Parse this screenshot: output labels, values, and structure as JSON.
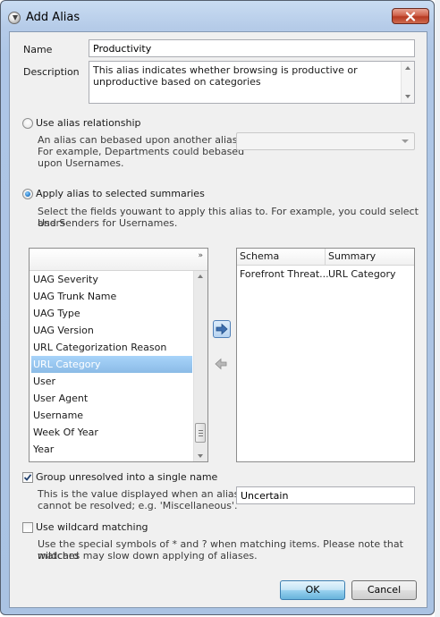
{
  "window": {
    "title": "Add Alias",
    "close_icon": "close-x"
  },
  "form": {
    "name_label": "Name",
    "name_value": "Productivity",
    "description_label": "Description",
    "description_value": "This alias indicates whether browsing is productive or unproductive based on categories"
  },
  "relationship": {
    "label": "Use alias relationship",
    "hint_line1": "An alias can bebased upon another alias.",
    "hint_line2": "For example, Departments could bebased",
    "hint_line3": "upon Usernames.",
    "combo_value": ""
  },
  "summaries": {
    "label": "Apply alias to selected summaries",
    "hint_line1": "Select the fields youwant to apply this alias to.  For example, you could select Users",
    "hint_line2": "and Senders for Usernames.",
    "list_header_button": "»",
    "fields": [
      "UAG Severity",
      "UAG Trunk Name",
      "UAG Type",
      "UAG Version",
      "URL Categorization Reason",
      "URL Category",
      "User",
      "User Agent",
      "Username",
      "Week Of Year",
      "Year"
    ],
    "selected_field": "URL Category",
    "grid_columns": [
      "Schema",
      "Summary"
    ],
    "grid_rows": [
      {
        "schema": "Forefront Threat...",
        "summary": "URL Category"
      }
    ]
  },
  "group": {
    "label": "Group unresolved into a single name",
    "checked": true,
    "hint_line1": "This is the value displayed when an alias",
    "hint_line2": "cannot be resolved; e.g. 'Miscellaneous'.",
    "value": "Uncertain"
  },
  "wildcard": {
    "label": "Use wildcard matching",
    "checked": false,
    "hint_line1": "Use the special symbols of * and ? when matching items.  Please note that wildcard",
    "hint_line2": "matches may slow down applying of aliases."
  },
  "buttons": {
    "ok": "OK",
    "cancel": "Cancel"
  },
  "colors": {
    "selection": "#99c8f2",
    "accent": "#3c7fb1",
    "close": "#c94a32"
  }
}
